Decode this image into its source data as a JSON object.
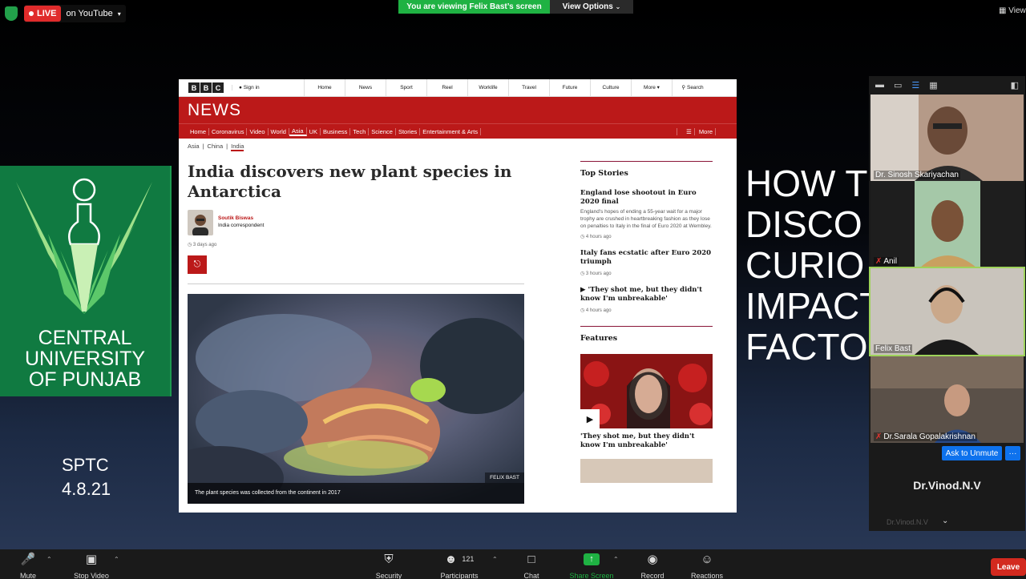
{
  "zoom_top": {
    "live_label": "LIVE",
    "live_target": "on YouTube",
    "viewing_banner": "You are viewing Felix Bast’s screen",
    "view_options": "View Options",
    "top_right_view": "View"
  },
  "slide": {
    "logo_lines": [
      "CENTRAL",
      "UNIVERSITY",
      "OF PUNJAB"
    ],
    "sptc_line1": "SPTC",
    "sptc_line2": "4.8.21",
    "right_lines": [
      "HOW T",
      "DISCO",
      "CURIO",
      "IMPACT",
      "FACTO"
    ]
  },
  "bbc": {
    "logo_letters": [
      "B",
      "B",
      "C"
    ],
    "sign_in": "Sign in",
    "nav": [
      "Home",
      "News",
      "Sport",
      "Reel",
      "Worklife",
      "Travel",
      "Future",
      "Culture",
      "More",
      "Search"
    ],
    "section": "NEWS",
    "subnav": [
      "Home",
      "Coronavirus",
      "Video",
      "World",
      "Asia",
      "UK",
      "Business",
      "Tech",
      "Science",
      "Stories",
      "Entertainment & Arts"
    ],
    "subnav_active": "Asia",
    "subnav_more": "More",
    "breadcrumb": [
      "Asia",
      "China",
      "India"
    ],
    "headline": "India discovers new plant species in Antarctica",
    "author_name": "Soutik Biswas",
    "author_role": "India correspondent",
    "published": "3 days ago",
    "image_credit": "FELIX BAST",
    "image_caption": "The plant species was collected from the continent in 2017",
    "top_stories_heading": "Top Stories",
    "top_stories": [
      {
        "title": "England lose shootout in Euro 2020 final",
        "summary": "England's hopes of ending a 55-year wait for a major trophy are crushed in heartbreaking fashion as they lose on penalties to Italy in the final of Euro 2020 at Wembley.",
        "time": "4 hours ago"
      },
      {
        "title": "Italy fans ecstatic after Euro 2020 triumph",
        "summary": "",
        "time": "3 hours ago"
      },
      {
        "title": "▶ 'They shot me, but they didn't know I'm unbreakable'",
        "summary": "",
        "time": "4 hours ago"
      }
    ],
    "features_heading": "Features",
    "feature_title": "'They shot me, but they didn't know I'm unbreakable'"
  },
  "participants": [
    {
      "name": "Dr. Sinosh Skariyachan",
      "muted": false
    },
    {
      "name": "Anil",
      "muted": true
    },
    {
      "name": "Felix Bast",
      "muted": false
    },
    {
      "name": "Dr.Sarala Gopalakrishnan",
      "muted": true
    }
  ],
  "ask_to_unmute": "Ask to Unmute",
  "more_dots": "···",
  "vinod_display": "Dr.Vinod.N.V",
  "vinod_name": "Dr.Vinod.N.V",
  "toolbar": {
    "mute": "Mute",
    "stop_video": "Stop Video",
    "security": "Security",
    "participants": "Participants",
    "participant_count": "121",
    "chat": "Chat",
    "share_screen": "Share Screen",
    "record": "Record",
    "reactions": "Reactions",
    "leave": "Leave"
  },
  "colors": {
    "bbc_red": "#bb1919",
    "zoom_green": "#1fb243",
    "zoom_blue": "#0e72ed",
    "leave_red": "#d32a1f",
    "cup_green": "#107a41"
  }
}
